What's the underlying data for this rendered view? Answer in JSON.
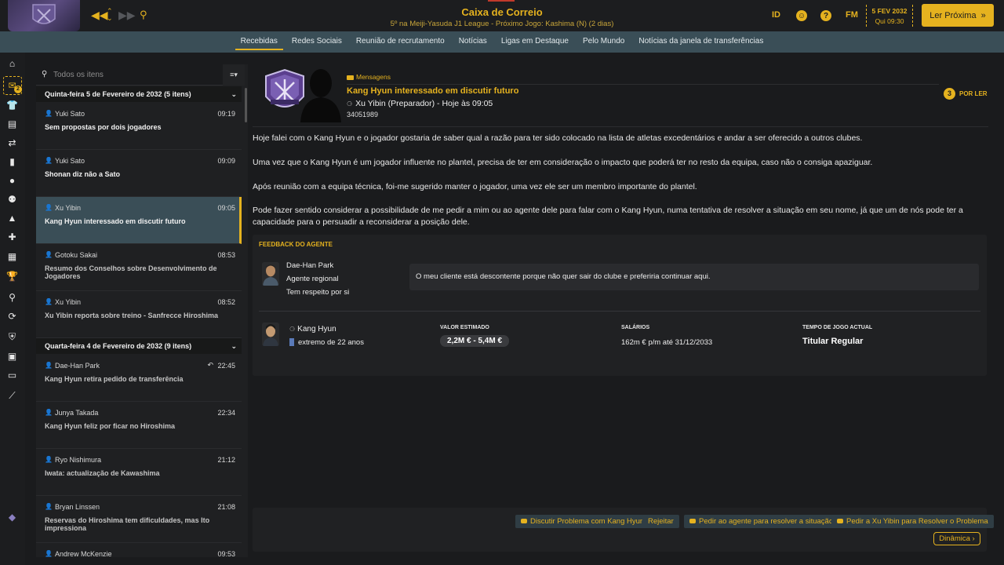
{
  "header": {
    "title": "Caixa de Correio",
    "subtitle": "5º na Meiji-Yasuda J1 League - Próximo Jogo: Kashima (N) (2 dias)",
    "id_label": "ID",
    "fm_label": "FM",
    "help_label": "?",
    "date": "5 FEV 2032",
    "time": "Qui 09:30",
    "continue_label": "Ler Próxima",
    "continue_icon": "»"
  },
  "tabs": [
    {
      "label": "Recebidas",
      "active": true
    },
    {
      "label": "Redes Sociais"
    },
    {
      "label": "Reunião de recrutamento"
    },
    {
      "label": "Notícias"
    },
    {
      "label": "Ligas em Destaque"
    },
    {
      "label": "Pelo Mundo"
    },
    {
      "label": "Notícias da janela de transferências"
    }
  ],
  "rail": {
    "inbox_badge": "2"
  },
  "list": {
    "search_placeholder": "Todos os itens",
    "filter_icon": "≡▾",
    "groups": [
      {
        "label": "Quinta-feira 5 de Fevereiro de 2032 (5 itens)"
      },
      {
        "label": "Quarta-feira 4 de Fevereiro de 2032 (9 itens)"
      }
    ],
    "messages": [
      {
        "sender": "Yuki Sato",
        "time": "09:19",
        "subject": "Sem propostas por dois jogadores"
      },
      {
        "sender": "Yuki Sato",
        "time": "09:09",
        "subject": "Shonan diz não a Sato"
      },
      {
        "sender": "Xu Yibin",
        "time": "09:05",
        "subject": "Kang Hyun interessado em discutir futuro"
      },
      {
        "sender": "Gotoku Sakai",
        "time": "08:53",
        "subject": "Resumo dos Conselhos sobre Desenvolvimento de Jogadores"
      },
      {
        "sender": "Xu Yibin",
        "time": "08:52",
        "subject": "Xu Yibin reporta sobre treino - Sanfrecce Hiroshima"
      },
      {
        "sender": "Dae-Han Park",
        "time": "22:45",
        "subject": "Kang Hyun retira pedido de transferência"
      },
      {
        "sender": "Junya Takada",
        "time": "22:34",
        "subject": "Kang Hyun feliz por ficar no Hiroshima"
      },
      {
        "sender": "Ryo Nishimura",
        "time": "21:12",
        "subject": "Iwata: actualização de Kawashima"
      },
      {
        "sender": "Bryan Linssen",
        "time": "21:08",
        "subject": "Reservas do Hiroshima tem dificuldades, mas Ito impressiona"
      },
      {
        "sender": "Andrew McKenzie",
        "time": "09:53",
        "subject": ""
      }
    ]
  },
  "message": {
    "type_label": "Mensagens",
    "title": "Kang Hyun interessado em discutir futuro",
    "from": "Xu Yibin (Preparador) - Hoje às 09:05",
    "id": "34051989",
    "unread_count": "3",
    "unread_label": "POR LER",
    "paragraphs": [
      "Hoje falei com o Kang Hyun e o jogador gostaria de saber qual a razão para ter sido colocado na lista de atletas excedentários e andar a ser oferecido a outros clubes.",
      "Uma vez que o Kang Hyun é um jogador influente no plantel, precisa de ter em consideração o impacto que poderá ter no resto da equipa, caso não o consiga apaziguar.",
      "Após reunião com a equipa técnica, foi-me sugerido manter o jogador, uma vez ele ser um membro importante do plantel.",
      "Pode fazer sentido considerar a possibilidade de me pedir a mim ou ao agente dele para falar com o Kang Hyun, numa tentativa de resolver a situação em seu nome, já que um de nós pode ter a capacidade para o persuadir a reconsiderar a posição dele."
    ]
  },
  "feedback": {
    "title": "FEEDBACK DO AGENTE",
    "agent_name": "Dae-Han Park",
    "agent_role": "Agente regional",
    "agent_trait": "Tem respeito por si",
    "quote": "O meu cliente está descontente porque não quer sair do clube e preferiria continuar aqui.",
    "player_name": "Kang Hyun",
    "player_desc": "extremo de 22 anos",
    "value_label": "VALOR ESTIMADO",
    "value": "2,2M € - 5,4M €",
    "salary_label": "SALÁRIOS",
    "salary": "162m € p/m até 31/12/2033",
    "playtime_label": "TEMPO DE JOGO ACTUAL",
    "playtime": "Titular Regular"
  },
  "actions": [
    {
      "label": "Discutir Problema com Kang Hyun"
    },
    {
      "label": "Rejeitar"
    },
    {
      "label": "Pedir ao agente para resolver a situação"
    },
    {
      "label": "Pedir a Xu Yibin para Resolver o Problema"
    }
  ],
  "dynamics_label": "Dinâmica",
  "colors": {
    "accent": "#e5b21f",
    "tabstrip": "#3a4e57",
    "background": "#1a1b1d"
  }
}
